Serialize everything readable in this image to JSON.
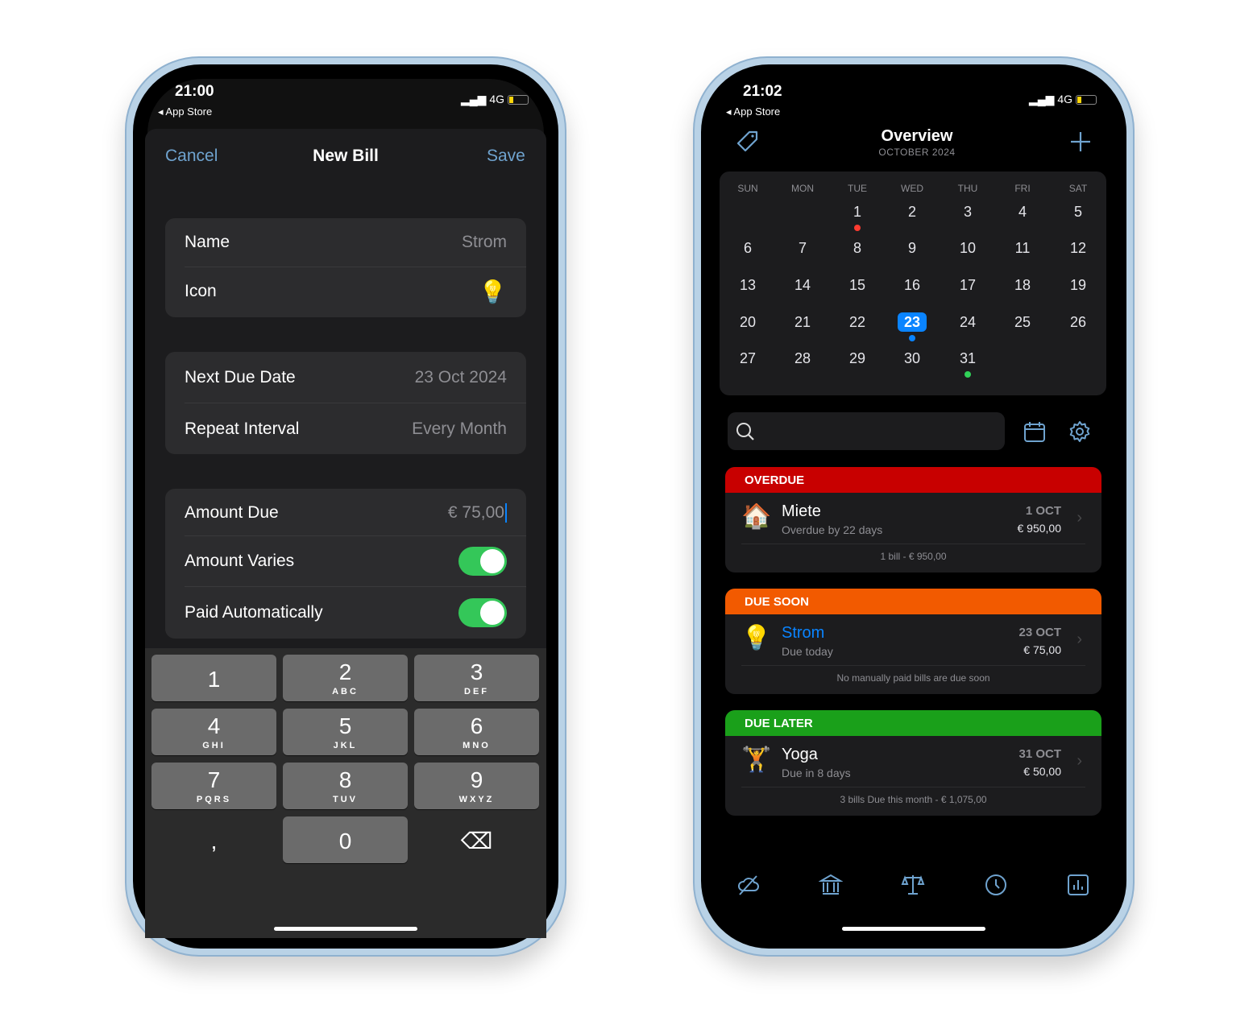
{
  "left_phone": {
    "status": {
      "time": "21:00",
      "back": "◂ App Store",
      "network": "4G"
    },
    "nav": {
      "cancel": "Cancel",
      "title": "New Bill",
      "save": "Save"
    },
    "fields": {
      "name": {
        "label": "Name",
        "value": "Strom"
      },
      "icon": {
        "label": "Icon",
        "value": "💡"
      },
      "next_due": {
        "label": "Next Due Date",
        "value": "23 Oct 2024"
      },
      "repeat": {
        "label": "Repeat Interval",
        "value": "Every Month"
      },
      "amount": {
        "label": "Amount Due",
        "value": "€ 75,00"
      },
      "varies": {
        "label": "Amount Varies",
        "on": true
      },
      "auto": {
        "label": "Paid Automatically",
        "on": true
      }
    },
    "keyboard": [
      [
        "1",
        ""
      ],
      [
        "2",
        "ABC"
      ],
      [
        "3",
        "DEF"
      ],
      [
        "4",
        "GHI"
      ],
      [
        "5",
        "JKL"
      ],
      [
        "6",
        "MNO"
      ],
      [
        "7",
        "PQRS"
      ],
      [
        "8",
        "TUV"
      ],
      [
        "9",
        "WXYZ"
      ],
      [
        ",",
        ""
      ],
      [
        "0",
        ""
      ],
      [
        "⌫",
        ""
      ]
    ]
  },
  "right_phone": {
    "status": {
      "time": "21:02",
      "back": "◂ App Store",
      "network": "4G"
    },
    "header": {
      "title": "Overview",
      "subtitle": "OCTOBER 2024"
    },
    "calendar": {
      "weekdays": [
        "SUN",
        "MON",
        "TUE",
        "WED",
        "THU",
        "FRI",
        "SAT"
      ],
      "first_weekday": 2,
      "days": 31,
      "selected": 23,
      "markers": {
        "1": "#ff3b30",
        "23": "#0a84ff",
        "31": "#30d158"
      }
    },
    "search": {
      "placeholder": ""
    },
    "sections": [
      {
        "title": "OVERDUE",
        "color": "#c80000",
        "name": "Miete",
        "icon": "🏠",
        "sub": "Overdue by 22 days",
        "date": "1 OCT",
        "amount": "€ 950,00",
        "footer": "1 bill - € 950,00",
        "highlight": false
      },
      {
        "title": "DUE SOON",
        "color": "#f25a00",
        "name": "Strom",
        "icon": "💡",
        "sub": "Due today",
        "date": "23 OCT",
        "amount": "€ 75,00",
        "footer": "No manually paid bills are due soon",
        "highlight": true
      },
      {
        "title": "DUE LATER",
        "color": "#1aa01a",
        "name": "Yoga",
        "icon": "🏋",
        "sub": "Due in 8 days",
        "date": "31 OCT",
        "amount": "€ 50,00",
        "footer": "3 bills Due this month - € 1,075,00",
        "highlight": false
      }
    ],
    "tabs": [
      "no-cloud-icon",
      "bank-icon",
      "scales-icon",
      "clock-icon",
      "chart-icon"
    ],
    "accent": "#6fa3cf"
  }
}
